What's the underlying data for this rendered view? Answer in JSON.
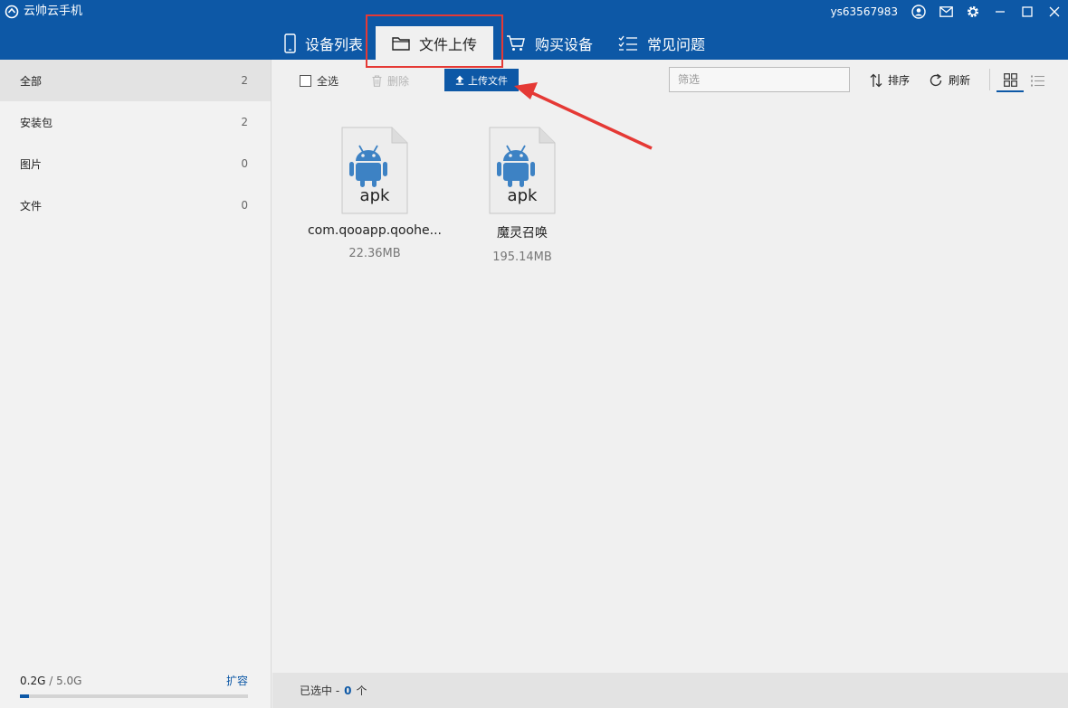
{
  "app": {
    "title": "云帅云手机",
    "username": "ys63567983"
  },
  "nav": {
    "tabs": [
      {
        "label": "设备列表"
      },
      {
        "label": "文件上传"
      },
      {
        "label": "购买设备"
      },
      {
        "label": "常见问题"
      }
    ]
  },
  "sidebar": {
    "items": [
      {
        "label": "全部",
        "count": "2"
      },
      {
        "label": "安装包",
        "count": "2"
      },
      {
        "label": "图片",
        "count": "0"
      },
      {
        "label": "文件",
        "count": "0"
      }
    ],
    "storage": {
      "used": "0.2G",
      "total": " / 5.0G",
      "expand": "扩容",
      "used_fraction": 0.04
    }
  },
  "toolbar": {
    "select_all": "全选",
    "delete": "删除",
    "upload": "上传文件",
    "filter_placeholder": "筛选",
    "sort": "排序",
    "refresh": "刷新"
  },
  "files": [
    {
      "type_label": "apk",
      "name": "com.qooapp.qoohe...",
      "size": "22.36MB"
    },
    {
      "type_label": "apk",
      "name": "魔灵召唤",
      "size": "195.14MB"
    }
  ],
  "status": {
    "prefix": "已选中 -",
    "count": "0",
    "suffix": "个"
  },
  "colors": {
    "brand": "#0d58a6",
    "highlight": "#e53935",
    "android": "#3d82c4"
  }
}
